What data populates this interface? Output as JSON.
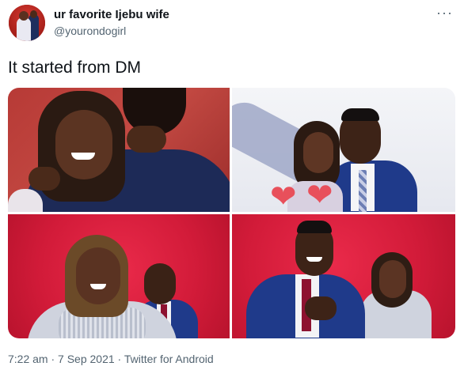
{
  "author": {
    "display_name": "ur favorite Ijebu wife",
    "handle": "@yourondogirl"
  },
  "more_icon": "more-horizontal-icon",
  "tweet": {
    "text": "It started from DM",
    "timestamp": "7:22 am · 7 Sep 2021 · Twitter for Android"
  },
  "media": [
    {
      "name": "photo-couple-embrace",
      "bg": "#b73a36"
    },
    {
      "name": "photo-couple-hearts",
      "bg": "#eef0f5"
    },
    {
      "name": "photo-woman-smiling",
      "bg": "#d21b39"
    },
    {
      "name": "photo-man-blue-suit",
      "bg": "#d21b39"
    }
  ],
  "colors": {
    "text_primary": "#0f1419",
    "text_secondary": "#536471",
    "heart": "#e8505b"
  }
}
